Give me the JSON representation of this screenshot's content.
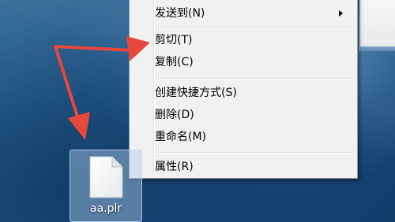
{
  "context_menu": {
    "items": [
      {
        "label": "发送到(N)",
        "has_submenu": true
      },
      {
        "label": "剪切(T)"
      },
      {
        "label": "复制(C)"
      },
      {
        "label": "创建快捷方式(S)"
      },
      {
        "label": "删除(D)"
      },
      {
        "label": "重命名(M)"
      },
      {
        "label": "属性(R)"
      }
    ]
  },
  "desktop": {
    "file_label": "aa.plr"
  },
  "colors": {
    "annotation_arrow": "#e8473b",
    "menu_background": "#f1f1f1",
    "selection": "#aacdeb"
  }
}
